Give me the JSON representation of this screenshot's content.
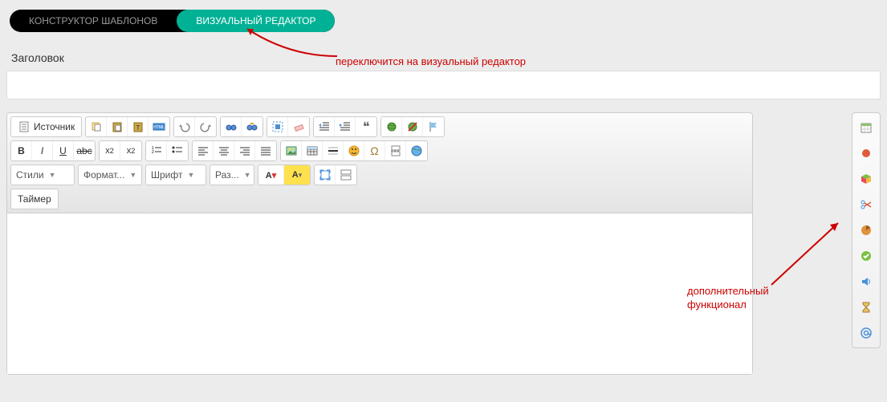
{
  "tabs": {
    "constructor": "КОНСТРУКТОР ШАБЛОНОВ",
    "visual": "ВИЗУАЛЬНЫЙ РЕДАКТОР"
  },
  "title_label": "Заголовок",
  "toolbar": {
    "source": "Источник",
    "styles": "Стили",
    "format": "Формат...",
    "font": "Шрифт",
    "size": "Раз...",
    "timer": "Таймер"
  },
  "annotations": {
    "switch_editor": "переключится на визуальный редактор",
    "extra_func_1": "дополнительный",
    "extra_func_2": "функционал"
  }
}
